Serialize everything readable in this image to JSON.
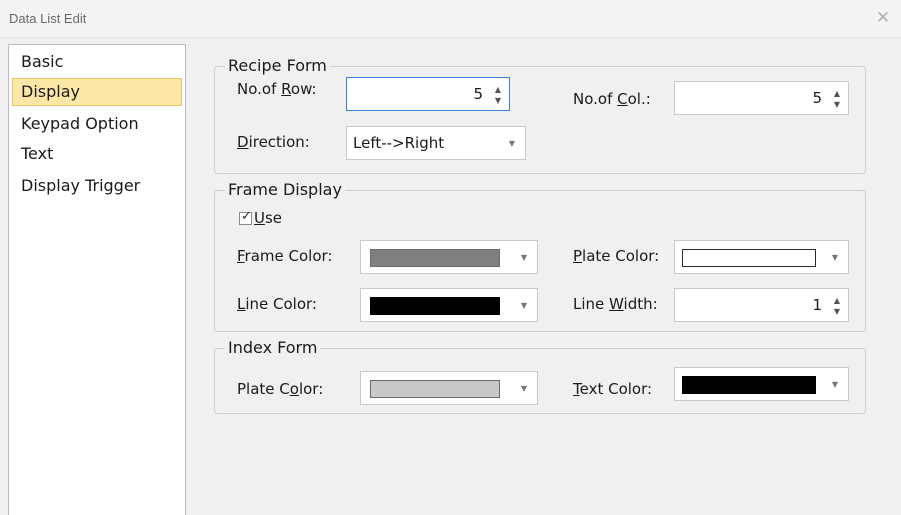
{
  "window": {
    "title": "Data List Edit"
  },
  "sidebar": {
    "items": [
      {
        "label": "Basic"
      },
      {
        "label": "Display"
      },
      {
        "label": "Keypad Option"
      },
      {
        "label": "Text"
      },
      {
        "label": "Display Trigger"
      }
    ],
    "selected": "Display"
  },
  "recipe_form": {
    "legend": "Recipe Form",
    "rows_label_pre": "No.of ",
    "rows_label_key": "R",
    "rows_label_post": "ow:",
    "rows_value": "5",
    "cols_label_pre": "No.of ",
    "cols_label_key": "C",
    "cols_label_post": "ol.:",
    "cols_value": "5",
    "direction_label_key": "D",
    "direction_label_post": "irection:",
    "direction_value": "Left-->Right"
  },
  "frame_display": {
    "legend": "Frame Display",
    "use_label_key": "U",
    "use_label_post": "se",
    "use_checked": true,
    "frame_color_label_key": "F",
    "frame_color_label_post": "rame Color:",
    "frame_color": "#7f7f7f",
    "plate_color_label_key": "P",
    "plate_color_label_post": "late Color:",
    "plate_color": "#ffffff",
    "line_color_label_key": "L",
    "line_color_label_post": "ine Color:",
    "line_color": "#000000",
    "line_width_label_pre": "Line ",
    "line_width_label_key": "W",
    "line_width_label_post": "idth:",
    "line_width_value": "1"
  },
  "index_form": {
    "legend": "Index Form",
    "plate_color_label_pre": "Plate C",
    "plate_color_label_key": "o",
    "plate_color_label_post": "lor:",
    "plate_color": "#c8c8c8",
    "text_color_label_key": "T",
    "text_color_label_post": "ext Color:",
    "text_color": "#000000"
  },
  "icons": {
    "close": "close-icon",
    "dropdown": "chevron-down-icon",
    "spin_up": "spin-up-icon",
    "spin_down": "spin-down-icon",
    "check": "checkmark-icon"
  }
}
